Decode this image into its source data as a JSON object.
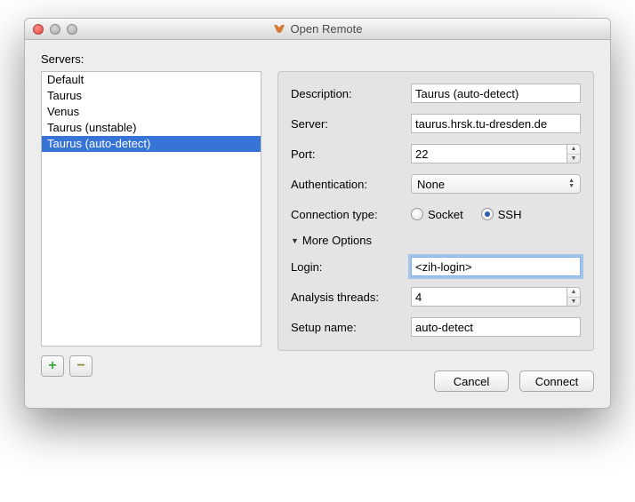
{
  "window": {
    "title": "Open Remote",
    "icon": "vampir-logo"
  },
  "servers_label": "Servers:",
  "servers": {
    "items": [
      {
        "label": "Default"
      },
      {
        "label": "Taurus"
      },
      {
        "label": "Venus"
      },
      {
        "label": "Taurus (unstable)"
      },
      {
        "label": "Taurus (auto-detect)"
      }
    ],
    "selected_index": 4
  },
  "form": {
    "description_label": "Description:",
    "description": "Taurus (auto-detect)",
    "server_label": "Server:",
    "server": "taurus.hrsk.tu-dresden.de",
    "port_label": "Port:",
    "port": "22",
    "auth_label": "Authentication:",
    "auth_value": "None",
    "conn_type_label": "Connection type:",
    "conn_socket_label": "Socket",
    "conn_ssh_label": "SSH",
    "conn_selected": "SSH",
    "more_options_label": "More Options",
    "login_label": "Login:",
    "login": "<zih-login>",
    "threads_label": "Analysis threads:",
    "threads": "4",
    "setup_label": "Setup name:",
    "setup": "auto-detect"
  },
  "buttons": {
    "add": "+",
    "remove": "−",
    "cancel": "Cancel",
    "connect": "Connect"
  }
}
